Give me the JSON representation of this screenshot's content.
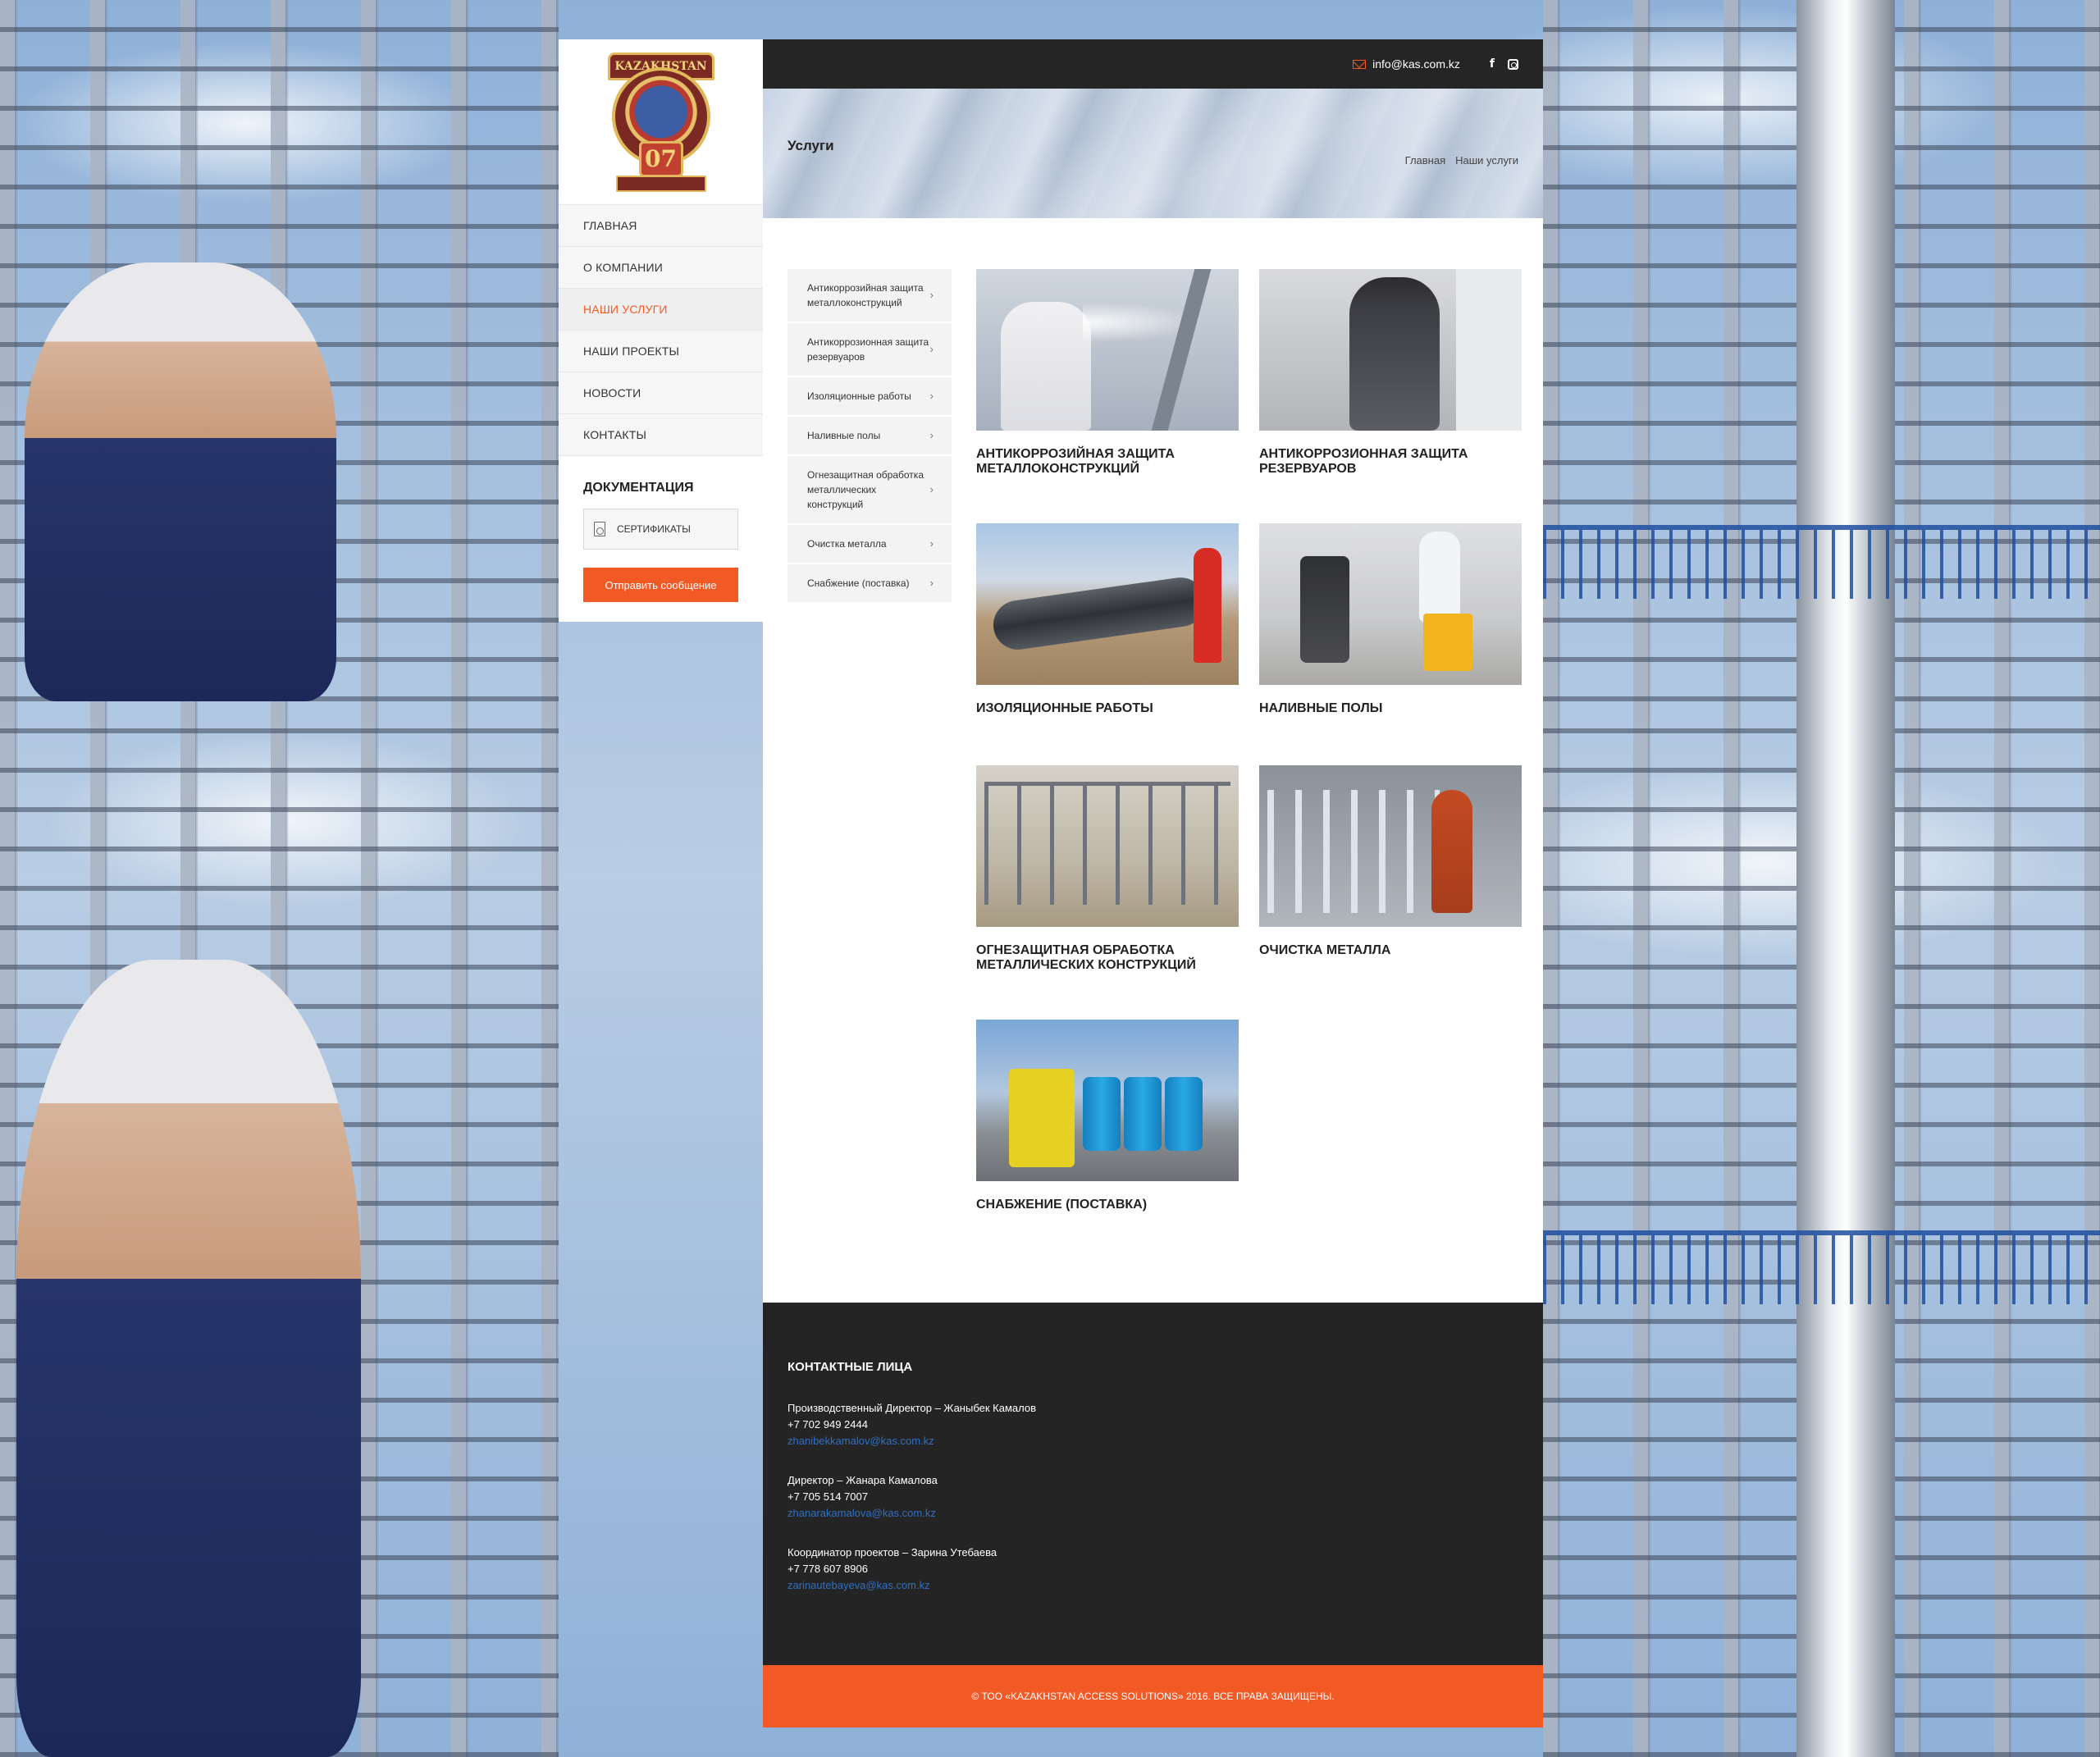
{
  "brand": {
    "logo_text": "KAZAKHSTAN",
    "logo_number": "07"
  },
  "nav": {
    "items": [
      {
        "label": "ГЛАВНАЯ",
        "active": false
      },
      {
        "label": "О КОМПАНИИ",
        "active": false
      },
      {
        "label": "НАШИ УСЛУГИ",
        "active": true
      },
      {
        "label": "НАШИ ПРОЕКТЫ",
        "active": false
      },
      {
        "label": "НОВОСТИ",
        "active": false
      },
      {
        "label": "КОНТАКТЫ",
        "active": false
      }
    ]
  },
  "docs": {
    "title": "ДОКУМЕНТАЦИЯ",
    "certificates_label": "СЕРТИФИКАТЫ",
    "send_button": "Отправить сообщение"
  },
  "topbar": {
    "email": "info@kas.com.kz",
    "facebook_icon": "f"
  },
  "banner": {
    "title": "Услуги",
    "breadcrumbs": [
      "Главная",
      "Наши услуги"
    ]
  },
  "service_menu": [
    "Антикоррозийная защита металлоконструкций",
    "Антикоррозионная защита резервуаров",
    "Изоляционные работы",
    "Наливные полы",
    "Огнезащитная обработка металлических конструкций",
    "Очистка металла",
    "Снабжение (поставка)"
  ],
  "services": [
    {
      "title": "АНТИКОРРОЗИЙНАЯ ЗАЩИТА МЕТАЛЛОКОНСТРУКЦИЙ"
    },
    {
      "title": "АНТИКОРРОЗИОННАЯ ЗАЩИТА РЕЗЕРВУАРОВ"
    },
    {
      "title": "ИЗОЛЯЦИОННЫЕ РАБОТЫ"
    },
    {
      "title": "НАЛИВНЫЕ ПОЛЫ"
    },
    {
      "title": "ОГНЕЗАЩИТНАЯ ОБРАБОТКА МЕТАЛЛИЧЕСКИХ КОНСТРУКЦИЙ"
    },
    {
      "title": "ОЧИСТКА МЕТАЛЛА"
    },
    {
      "title": "СНАБЖЕНИЕ (ПОСТАВКА)"
    }
  ],
  "footer": {
    "title": "КОНТАКТНЫЕ ЛИЦА",
    "contacts": [
      {
        "role": "Производственный Директор – Жаныбек Камалов",
        "phone": "+7 702 949 2444",
        "email": "zhanibekkamalov@kas.com.kz"
      },
      {
        "role": "Директор – Жанара Камалова",
        "phone": "+7 705 514 7007",
        "email": "zhanarakamalova@kas.com.kz"
      },
      {
        "role": "Координатор проектов – Зарина Утебаева",
        "phone": "+7 778 607 8906",
        "email": "zarinautebayeva@kas.com.kz"
      }
    ],
    "copyright": "© ТОО «KAZAKHSTAN ACCESS SOLUTIONS» 2016. ВСЕ ПРАВА ЗАЩИЩЕНЫ."
  },
  "colors": {
    "accent": "#f15a24",
    "dark": "#252525",
    "link": "#2f6fc2"
  }
}
